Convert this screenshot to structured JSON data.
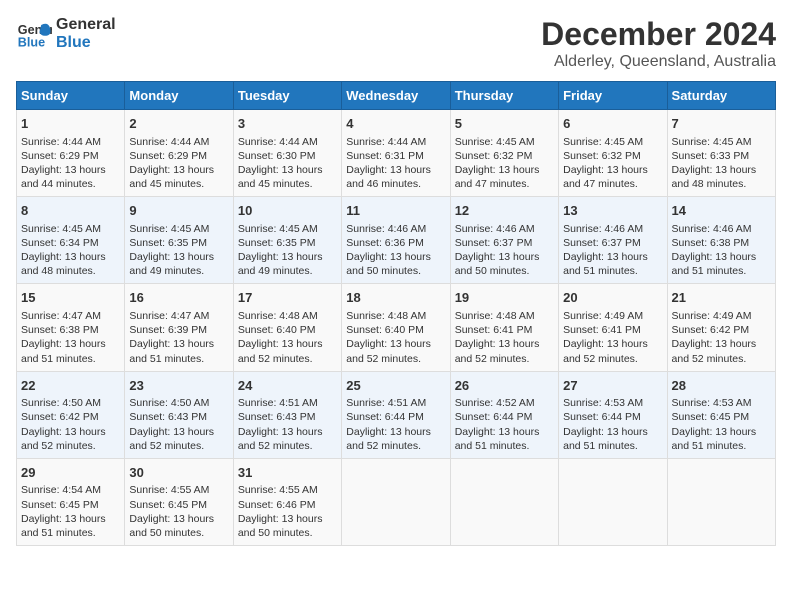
{
  "header": {
    "logo_line1": "General",
    "logo_line2": "Blue",
    "title": "December 2024",
    "subtitle": "Alderley, Queensland, Australia"
  },
  "days_of_week": [
    "Sunday",
    "Monday",
    "Tuesday",
    "Wednesday",
    "Thursday",
    "Friday",
    "Saturday"
  ],
  "weeks": [
    [
      {
        "day": "1",
        "info": "Sunrise: 4:44 AM\nSunset: 6:29 PM\nDaylight: 13 hours\nand 44 minutes."
      },
      {
        "day": "2",
        "info": "Sunrise: 4:44 AM\nSunset: 6:29 PM\nDaylight: 13 hours\nand 45 minutes."
      },
      {
        "day": "3",
        "info": "Sunrise: 4:44 AM\nSunset: 6:30 PM\nDaylight: 13 hours\nand 45 minutes."
      },
      {
        "day": "4",
        "info": "Sunrise: 4:44 AM\nSunset: 6:31 PM\nDaylight: 13 hours\nand 46 minutes."
      },
      {
        "day": "5",
        "info": "Sunrise: 4:45 AM\nSunset: 6:32 PM\nDaylight: 13 hours\nand 47 minutes."
      },
      {
        "day": "6",
        "info": "Sunrise: 4:45 AM\nSunset: 6:32 PM\nDaylight: 13 hours\nand 47 minutes."
      },
      {
        "day": "7",
        "info": "Sunrise: 4:45 AM\nSunset: 6:33 PM\nDaylight: 13 hours\nand 48 minutes."
      }
    ],
    [
      {
        "day": "8",
        "info": "Sunrise: 4:45 AM\nSunset: 6:34 PM\nDaylight: 13 hours\nand 48 minutes."
      },
      {
        "day": "9",
        "info": "Sunrise: 4:45 AM\nSunset: 6:35 PM\nDaylight: 13 hours\nand 49 minutes."
      },
      {
        "day": "10",
        "info": "Sunrise: 4:45 AM\nSunset: 6:35 PM\nDaylight: 13 hours\nand 49 minutes."
      },
      {
        "day": "11",
        "info": "Sunrise: 4:46 AM\nSunset: 6:36 PM\nDaylight: 13 hours\nand 50 minutes."
      },
      {
        "day": "12",
        "info": "Sunrise: 4:46 AM\nSunset: 6:37 PM\nDaylight: 13 hours\nand 50 minutes."
      },
      {
        "day": "13",
        "info": "Sunrise: 4:46 AM\nSunset: 6:37 PM\nDaylight: 13 hours\nand 51 minutes."
      },
      {
        "day": "14",
        "info": "Sunrise: 4:46 AM\nSunset: 6:38 PM\nDaylight: 13 hours\nand 51 minutes."
      }
    ],
    [
      {
        "day": "15",
        "info": "Sunrise: 4:47 AM\nSunset: 6:38 PM\nDaylight: 13 hours\nand 51 minutes."
      },
      {
        "day": "16",
        "info": "Sunrise: 4:47 AM\nSunset: 6:39 PM\nDaylight: 13 hours\nand 51 minutes."
      },
      {
        "day": "17",
        "info": "Sunrise: 4:48 AM\nSunset: 6:40 PM\nDaylight: 13 hours\nand 52 minutes."
      },
      {
        "day": "18",
        "info": "Sunrise: 4:48 AM\nSunset: 6:40 PM\nDaylight: 13 hours\nand 52 minutes."
      },
      {
        "day": "19",
        "info": "Sunrise: 4:48 AM\nSunset: 6:41 PM\nDaylight: 13 hours\nand 52 minutes."
      },
      {
        "day": "20",
        "info": "Sunrise: 4:49 AM\nSunset: 6:41 PM\nDaylight: 13 hours\nand 52 minutes."
      },
      {
        "day": "21",
        "info": "Sunrise: 4:49 AM\nSunset: 6:42 PM\nDaylight: 13 hours\nand 52 minutes."
      }
    ],
    [
      {
        "day": "22",
        "info": "Sunrise: 4:50 AM\nSunset: 6:42 PM\nDaylight: 13 hours\nand 52 minutes."
      },
      {
        "day": "23",
        "info": "Sunrise: 4:50 AM\nSunset: 6:43 PM\nDaylight: 13 hours\nand 52 minutes."
      },
      {
        "day": "24",
        "info": "Sunrise: 4:51 AM\nSunset: 6:43 PM\nDaylight: 13 hours\nand 52 minutes."
      },
      {
        "day": "25",
        "info": "Sunrise: 4:51 AM\nSunset: 6:44 PM\nDaylight: 13 hours\nand 52 minutes."
      },
      {
        "day": "26",
        "info": "Sunrise: 4:52 AM\nSunset: 6:44 PM\nDaylight: 13 hours\nand 51 minutes."
      },
      {
        "day": "27",
        "info": "Sunrise: 4:53 AM\nSunset: 6:44 PM\nDaylight: 13 hours\nand 51 minutes."
      },
      {
        "day": "28",
        "info": "Sunrise: 4:53 AM\nSunset: 6:45 PM\nDaylight: 13 hours\nand 51 minutes."
      }
    ],
    [
      {
        "day": "29",
        "info": "Sunrise: 4:54 AM\nSunset: 6:45 PM\nDaylight: 13 hours\nand 51 minutes."
      },
      {
        "day": "30",
        "info": "Sunrise: 4:55 AM\nSunset: 6:45 PM\nDaylight: 13 hours\nand 50 minutes."
      },
      {
        "day": "31",
        "info": "Sunrise: 4:55 AM\nSunset: 6:46 PM\nDaylight: 13 hours\nand 50 minutes."
      },
      {
        "day": "",
        "info": ""
      },
      {
        "day": "",
        "info": ""
      },
      {
        "day": "",
        "info": ""
      },
      {
        "day": "",
        "info": ""
      }
    ]
  ]
}
